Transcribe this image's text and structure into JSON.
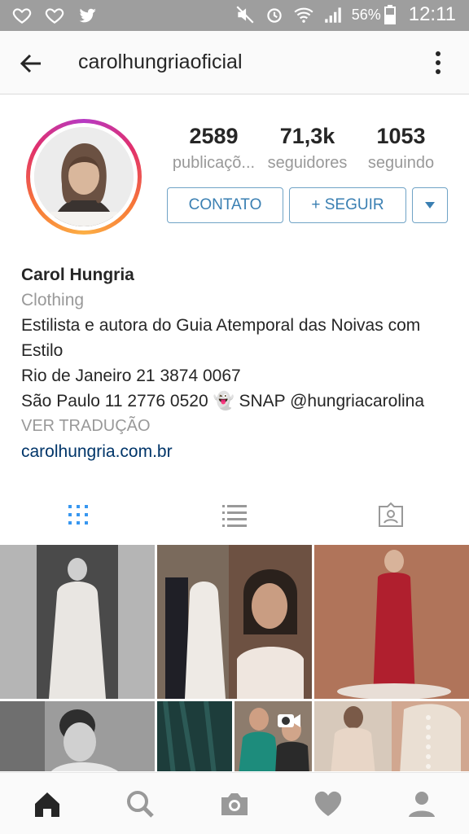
{
  "status_bar": {
    "battery": "56%",
    "time": "12:11"
  },
  "header": {
    "username": "carolhungriaoficial"
  },
  "profile": {
    "stats": [
      {
        "value": "2589",
        "label": "publicaçõ..."
      },
      {
        "value": "71,3k",
        "label": "seguidores"
      },
      {
        "value": "1053",
        "label": "seguindo"
      }
    ],
    "buttons": {
      "contact": "CONTATO",
      "follow": "+ SEGUIR"
    }
  },
  "bio": {
    "name": "Carol Hungria",
    "category": "Clothing",
    "line1": "Estilista e autora do Guia Atemporal das Noivas com",
    "line2": "Estilo",
    "line3": "Rio de Janeiro 21 3874 0067",
    "line4": "São Paulo 11 2776 0520 👻 SNAP @hungriacarolina",
    "translate": "VER TRADUÇÃO",
    "website": "carolhungria.com.br"
  },
  "colors": {
    "accent": "#3897f0",
    "button_border": "#70a3c6",
    "link": "#003569",
    "muted": "#999999"
  },
  "icons": {
    "status_left": [
      "heart-outline-icon",
      "heart-outline-icon",
      "twitter-icon"
    ],
    "status_right": [
      "mute-icon",
      "alarm-icon",
      "wifi-icon",
      "signal-icon",
      "battery-icon"
    ],
    "tabs": [
      "grid-icon",
      "list-icon",
      "tagged-icon"
    ],
    "nav": [
      "home-icon",
      "search-icon",
      "camera-icon",
      "heart-icon",
      "profile-icon"
    ]
  }
}
